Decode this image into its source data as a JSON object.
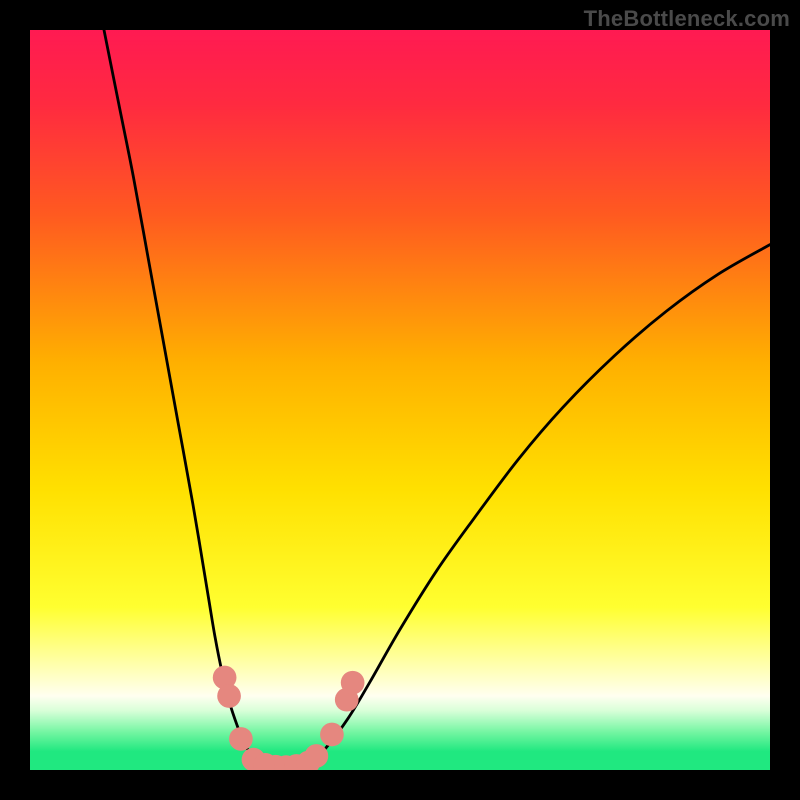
{
  "watermark": "TheBottleneck.com",
  "chart_data": {
    "type": "line",
    "title": "",
    "xlabel": "",
    "ylabel": "",
    "xlim": [
      0,
      100
    ],
    "ylim": [
      0,
      100
    ],
    "grid": false,
    "background_gradient": [
      {
        "pos": 0.0,
        "color": "#ff1a52"
      },
      {
        "pos": 0.1,
        "color": "#ff2a40"
      },
      {
        "pos": 0.25,
        "color": "#ff5a20"
      },
      {
        "pos": 0.45,
        "color": "#ffb000"
      },
      {
        "pos": 0.62,
        "color": "#ffe000"
      },
      {
        "pos": 0.78,
        "color": "#ffff30"
      },
      {
        "pos": 0.85,
        "color": "#ffffa0"
      },
      {
        "pos": 0.9,
        "color": "#fffff0"
      },
      {
        "pos": 0.92,
        "color": "#d8ffd8"
      },
      {
        "pos": 0.95,
        "color": "#70f5a0"
      },
      {
        "pos": 0.975,
        "color": "#20e880"
      },
      {
        "pos": 1.0,
        "color": "#20e880"
      }
    ],
    "series": [
      {
        "name": "left-curve",
        "color": "#000000",
        "x": [
          10,
          12,
          14,
          16,
          18,
          20,
          22,
          24,
          25,
          26,
          27,
          28,
          29,
          30,
          31
        ],
        "y": [
          100,
          90,
          80,
          69,
          58,
          47,
          36,
          24,
          18,
          13,
          9,
          6,
          3.5,
          2,
          1
        ]
      },
      {
        "name": "right-curve",
        "color": "#000000",
        "x": [
          38,
          40,
          43,
          46,
          50,
          55,
          60,
          66,
          72,
          79,
          86,
          93,
          100
        ],
        "y": [
          1,
          3,
          7,
          12,
          19,
          27,
          34,
          42,
          49,
          56,
          62,
          67,
          71
        ]
      },
      {
        "name": "valley-floor",
        "color": "#000000",
        "x": [
          31,
          32,
          33,
          34,
          35,
          36,
          37,
          38
        ],
        "y": [
          1,
          0.5,
          0.3,
          0.25,
          0.25,
          0.3,
          0.5,
          1
        ]
      }
    ],
    "markers": {
      "name": "highlight-dots",
      "color": "#e5877f",
      "radius": 1.6,
      "points": [
        {
          "x": 26.3,
          "y": 12.5
        },
        {
          "x": 26.9,
          "y": 10.0
        },
        {
          "x": 28.5,
          "y": 4.2
        },
        {
          "x": 30.2,
          "y": 1.4
        },
        {
          "x": 31.8,
          "y": 0.7
        },
        {
          "x": 33.2,
          "y": 0.45
        },
        {
          "x": 34.6,
          "y": 0.4
        },
        {
          "x": 36.0,
          "y": 0.55
        },
        {
          "x": 37.6,
          "y": 1.0
        },
        {
          "x": 38.7,
          "y": 1.9
        },
        {
          "x": 40.8,
          "y": 4.8
        },
        {
          "x": 42.8,
          "y": 9.5
        },
        {
          "x": 43.6,
          "y": 11.8
        }
      ]
    }
  }
}
